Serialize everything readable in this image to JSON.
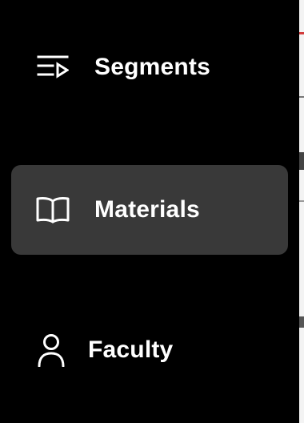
{
  "sidebar": {
    "items": [
      {
        "id": "segments",
        "label": "Segments",
        "icon": "playlist-play-icon",
        "active": false
      },
      {
        "id": "materials",
        "label": "Materials",
        "icon": "open-book-icon",
        "active": true
      },
      {
        "id": "faculty",
        "label": "Faculty",
        "icon": "person-icon",
        "active": false
      }
    ]
  },
  "colors": {
    "background": "#000000",
    "active_item": "#393939",
    "text": "#ffffff",
    "edge_accent": "#d23c3c"
  }
}
